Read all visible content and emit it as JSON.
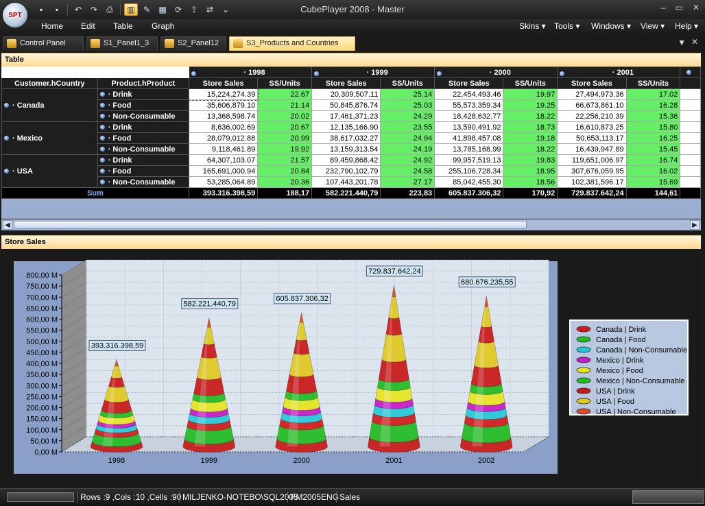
{
  "app": {
    "title": "CubePlayer 2008 - Master",
    "orb_label": "SPT",
    "window_controls": [
      "–",
      "▭",
      "✕"
    ]
  },
  "menu": {
    "left": [
      "Home",
      "Edit",
      "Table",
      "Graph"
    ],
    "right": [
      "Skins",
      "Tools",
      "Windows",
      "View",
      "Help"
    ]
  },
  "tabs": [
    {
      "label": "Control Panel",
      "active": false
    },
    {
      "label": "S1_Panel1_3",
      "active": false
    },
    {
      "label": "S2_Panel12",
      "active": false
    },
    {
      "label": "S3_Products and Countries",
      "active": true
    }
  ],
  "table_panel": {
    "title": "Table",
    "row_header_1": "Customer.hCountry",
    "row_header_2": "Product.hProduct",
    "years": [
      "· 1998",
      "· 1999",
      "· 2000",
      "· 2001"
    ],
    "measures": [
      "Store Sales",
      "SS/Units"
    ],
    "rows": [
      {
        "country": "· Canada",
        "product": "· Drink",
        "values": [
          "15,224,274.39",
          "22.67",
          "20,309,507.11",
          "25.14",
          "22,454,493.46",
          "19.97",
          "27,494,973.36",
          "17.02"
        ]
      },
      {
        "country": "",
        "product": "· Food",
        "values": [
          "35,606,879.10",
          "21.14",
          "50,845,876.74",
          "25.03",
          "55,573,359.34",
          "19.25",
          "66,673,861.10",
          "16.28"
        ]
      },
      {
        "country": "",
        "product": "· Non-Consumable",
        "values": [
          "13,368,598.74",
          "20.02",
          "17,461,371.23",
          "24.29",
          "18,428,632.77",
          "18.22",
          "22,256,210.39",
          "15.36"
        ]
      },
      {
        "country": "· Mexico",
        "product": "· Drink",
        "values": [
          "8,636,002.69",
          "20.67",
          "12,135,166.90",
          "23.55",
          "13,590,491.92",
          "18.73",
          "16,610,873.25",
          "15.80"
        ]
      },
      {
        "country": "",
        "product": "· Food",
        "values": [
          "28,079,012.88",
          "20.99",
          "38,617,032.27",
          "24.94",
          "41,898,457.08",
          "19.18",
          "50,653,113.17",
          "16.25"
        ]
      },
      {
        "country": "",
        "product": "· Non-Consumable",
        "values": [
          "9,118,461.89",
          "19.92",
          "13,159,313.54",
          "24.19",
          "13,785,168.99",
          "18.22",
          "16,439,947.89",
          "15.45"
        ]
      },
      {
        "country": "· USA",
        "product": "· Drink",
        "values": [
          "64,307,103.07",
          "21.57",
          "89,459,868.42",
          "24.92",
          "99,957,519.13",
          "19.83",
          "119,651,006.97",
          "16.74"
        ]
      },
      {
        "country": "",
        "product": "· Food",
        "values": [
          "165,691,000.94",
          "20.84",
          "232,790,102.79",
          "24.58",
          "255,106,728.34",
          "18.95",
          "307,676,059.95",
          "16.02"
        ]
      },
      {
        "country": "",
        "product": "· Non-Consumable",
        "values": [
          "53,285,064.89",
          "20.36",
          "107,443,201.78",
          "27.17",
          "85,042,455.30",
          "18.56",
          "102,381,596.17",
          "15.69"
        ]
      }
    ],
    "sum_label": "Sum",
    "sum_values": [
      "393.316.398,59",
      "188,17",
      "582.221.440,79",
      "223,83",
      "605.837.306,32",
      "170,92",
      "729.837.642,24",
      "144,61"
    ]
  },
  "chart_panel": {
    "title": "Store Sales"
  },
  "chart_data": {
    "type": "bar",
    "title": "",
    "categories": [
      "1998",
      "1999",
      "2000",
      "2001",
      "2002"
    ],
    "ylim": [
      0,
      800
    ],
    "yticks": [
      "0,00 M",
      "50,00 M",
      "100,00 M",
      "150,00 M",
      "200,00 M",
      "250,00 M",
      "300,00 M",
      "350,00 M",
      "400,00 M",
      "450,00 M",
      "500,00 M",
      "550,00 M",
      "600,00 M",
      "650,00 M",
      "700,00 M",
      "750,00 M",
      "800,00 M"
    ],
    "totals": [
      393.316398,
      582.221441,
      605.837306,
      729.837642,
      680.676236
    ],
    "total_labels": [
      "393.316.398,59",
      "582.221.440,79",
      "605.837.306,32",
      "729.837.642,24",
      "680.676.235,55"
    ],
    "grid": true,
    "legend_position": "right",
    "series": [
      {
        "name": "Canada | Drink",
        "color": "#d21a1a"
      },
      {
        "name": "Canada | Food",
        "color": "#22bb22"
      },
      {
        "name": "Canada | Non-Consumable",
        "color": "#22c8d8"
      },
      {
        "name": "Mexico | Drink",
        "color": "#c81ac8"
      },
      {
        "name": "Mexico | Food",
        "color": "#e6e620"
      },
      {
        "name": "Mexico | Non-Consumable",
        "color": "#22bb22"
      },
      {
        "name": "USA | Drink",
        "color": "#c81818"
      },
      {
        "name": "USA | Food",
        "color": "#e0c820"
      },
      {
        "name": "USA | Non-Consumable",
        "color": "#d84a28"
      }
    ]
  },
  "status": {
    "counts": "Rows :9 ,Cols :10 ,Cells :90",
    "server": "MILJENKO-NOTEBO\\SQL2005",
    "database": "FM2005ENG",
    "cube": "Sales"
  }
}
